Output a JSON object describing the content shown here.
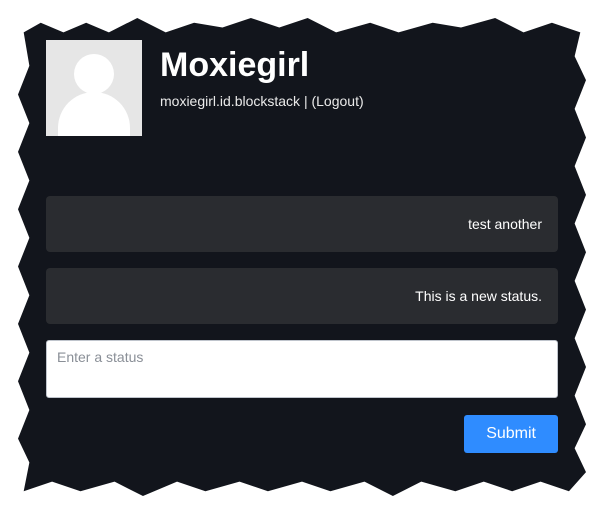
{
  "header": {
    "username": "Moxiegirl",
    "identity": "moxiegirl.id.blockstack",
    "separator": " | ",
    "logout_label": "(Logout)"
  },
  "statuses": [
    {
      "text": "test another"
    },
    {
      "text": "This is a new status."
    }
  ],
  "compose": {
    "placeholder": "Enter a status",
    "value": ""
  },
  "actions": {
    "submit_label": "Submit"
  }
}
